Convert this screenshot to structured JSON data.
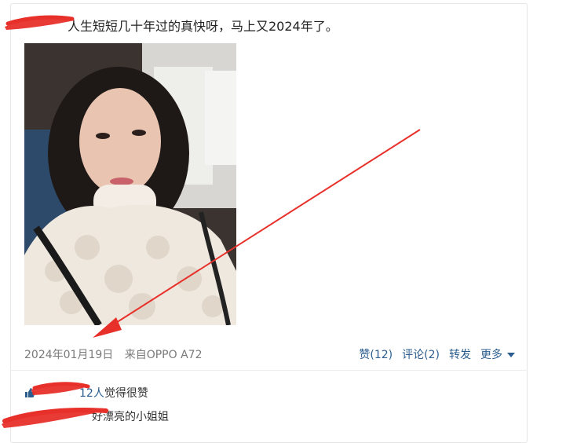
{
  "post": {
    "text": "人生短短几十年过的真快呀，马上又2024年了。",
    "date": "2024年01月19日",
    "source": "来自OPPO A72"
  },
  "actions": {
    "like": "赞(12)",
    "comment": "评论(2)",
    "forward": "转发",
    "more": "更多"
  },
  "likes": {
    "count_text": "12人",
    "suffix": "觉得很赞"
  },
  "comment": {
    "text": "好漂亮的小姐姐"
  },
  "colors": {
    "link": "#2b5d8f",
    "meta": "#7a7a7a",
    "annotation": "#e8302a"
  }
}
